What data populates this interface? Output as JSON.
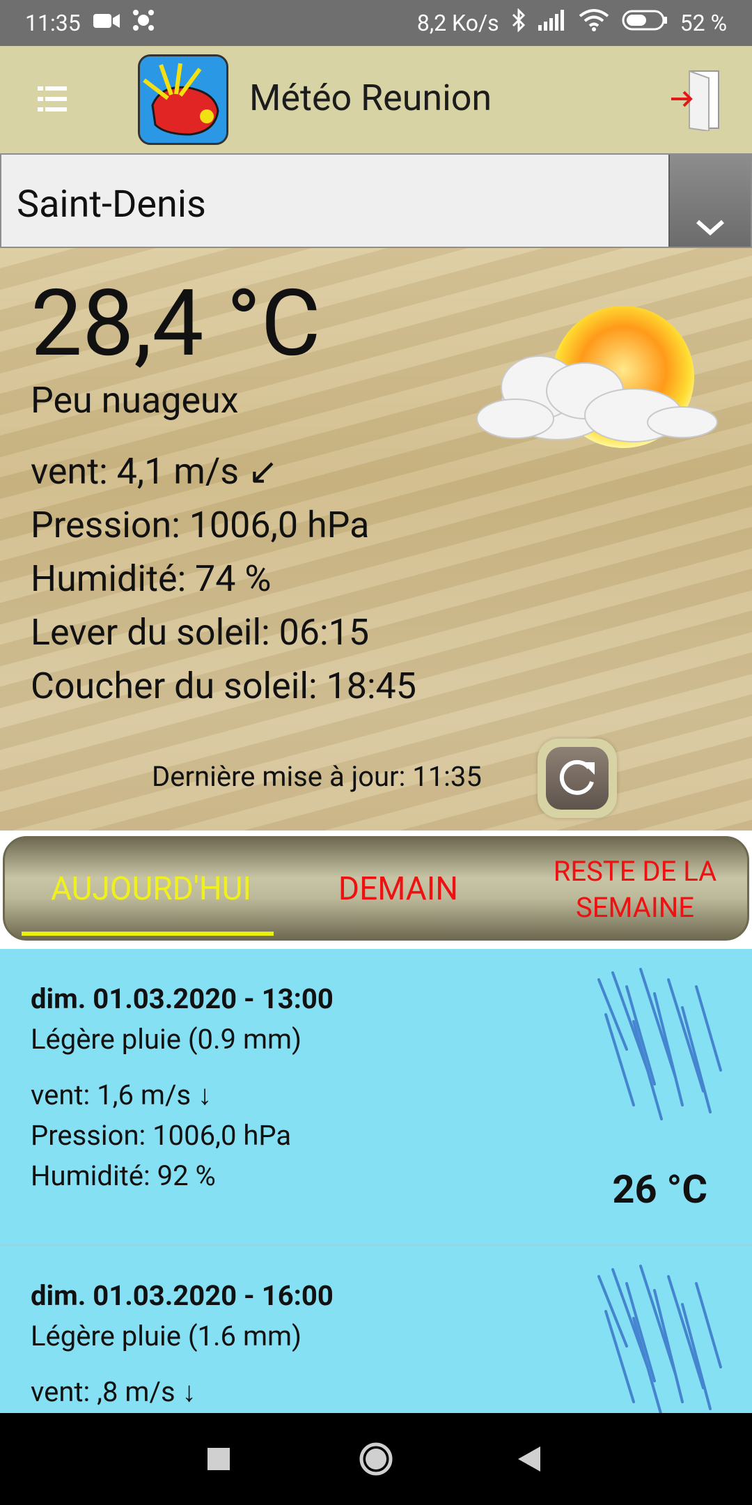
{
  "status_bar": {
    "time": "11:35",
    "network_speed": "8,2 Ko/s",
    "battery_percent": "52 %"
  },
  "app_bar": {
    "title": "Météo Reunion",
    "menu_icon": "hamburger-icon",
    "exit_icon": "exit-door-icon"
  },
  "location_select": {
    "selected": "Saint-Denis"
  },
  "current": {
    "temperature": "28,4 °C",
    "condition": "Peu nuageux",
    "wind": "vent: 4,1 m/s ↙",
    "pressure": "Pression: 1006,0 hPa",
    "humidity": "Humidité: 74 %",
    "sunrise": "Lever du soleil: 06:15",
    "sunset": "Coucher du soleil: 18:45",
    "last_update": "Dernière mise à jour: 11:35",
    "weather_icon": "sun-cloud-icon"
  },
  "tabs": {
    "today": "AUJOURD'HUI",
    "tomorrow": "DEMAIN",
    "week_line1": "RESTE DE LA",
    "week_line2": "SEMAINE"
  },
  "forecast": [
    {
      "datetime": "dim. 01.03.2020 - 13:00",
      "description": "Légère pluie (0.9 mm)",
      "wind": "vent: 1,6 m/s ↓",
      "pressure": "Pression: 1006,0 hPa",
      "humidity": "Humidité: 92 %",
      "temperature": "26 °C",
      "icon": "rain-icon"
    },
    {
      "datetime": "dim. 01.03.2020 - 16:00",
      "description": "Légère pluie (1.6 mm)",
      "wind": "vent: ,8 m/s ↓",
      "icon": "rain-icon"
    }
  ],
  "colors": {
    "status_bar": "#6f6f6f",
    "app_bar": "#d7d3a4",
    "list_bg": "#86e0f3",
    "tab_active": "#f0f020",
    "tab_inactive": "#ee1111"
  }
}
